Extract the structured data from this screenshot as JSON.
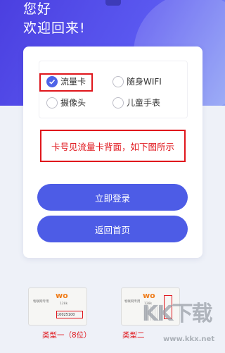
{
  "header": {
    "line1": "您好",
    "line2": "欢迎回来!"
  },
  "options": [
    {
      "label": "流量卡",
      "checked": true
    },
    {
      "label": "随身WIFI",
      "checked": false
    },
    {
      "label": "摄像头",
      "checked": false
    },
    {
      "label": "儿童手表",
      "checked": false
    }
  ],
  "notice": "卡号见流量卡背面，如下图所示",
  "buttons": {
    "login": "立即登录",
    "home": "返回首页"
  },
  "samples": [
    {
      "caption": "类型一（8位）",
      "brand": "物联网专用",
      "number": "10025100"
    },
    {
      "caption": "类型二",
      "brand": "物联网专用"
    }
  ],
  "watermark": {
    "mark": "KK下载",
    "url": "www.kkx.net"
  },
  "colors": {
    "accent": "#4d5ce6",
    "alert": "#e0161c"
  }
}
